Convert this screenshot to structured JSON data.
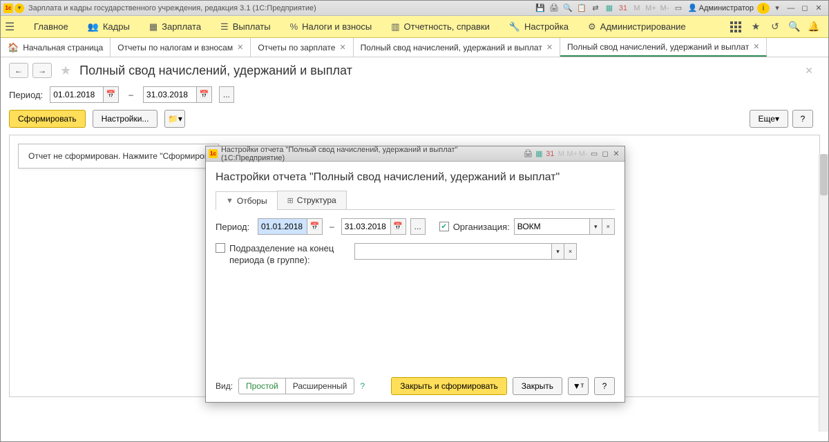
{
  "titlebar": {
    "app_title": "Зарплата и кадры государственного учреждения, редакция 3.1  (1С:Предприятие)",
    "admin_label": "Администратор",
    "m_labels": [
      "M",
      "M+",
      "M-"
    ]
  },
  "menu": {
    "items": [
      {
        "icon": "≡",
        "label": "Главное"
      },
      {
        "icon": "👥",
        "label": "Кадры"
      },
      {
        "icon": "▦",
        "label": "Зарплата"
      },
      {
        "icon": "☰",
        "label": "Выплаты"
      },
      {
        "icon": "%",
        "label": "Налоги и взносы"
      },
      {
        "icon": "▥",
        "label": "Отчетность, справки"
      },
      {
        "icon": "🔧",
        "label": "Настройка"
      },
      {
        "icon": "⚙",
        "label": "Администрирование"
      }
    ]
  },
  "tabs": [
    {
      "label": "Начальная страница",
      "closable": false,
      "home": true
    },
    {
      "label": "Отчеты по налогам и взносам",
      "closable": true
    },
    {
      "label": "Отчеты по зарплате",
      "closable": true
    },
    {
      "label": "Полный свод начислений, удержаний и выплат",
      "closable": true
    },
    {
      "label": "Полный свод начислений, удержаний и выплат",
      "closable": true,
      "active": true
    }
  ],
  "page": {
    "title": "Полный свод начислений, удержаний и выплат",
    "period_label": "Период:",
    "date_from": "01.01.2018",
    "date_to": "31.03.2018",
    "dash": "–",
    "btn_form": "Сформировать",
    "btn_settings": "Настройки...",
    "btn_more": "Еще",
    "btn_help": "?",
    "report_msg": "Отчет не сформирован. Нажмите \"Сформиров"
  },
  "dialog": {
    "title": "Настройки отчета \"Полный свод начислений, удержаний и выплат\"  (1С:Предприятие)",
    "heading": "Настройки отчета \"Полный свод начислений, удержаний и выплат\"",
    "tab_filters": "Отборы",
    "tab_structure": "Структура",
    "period_label": "Период:",
    "date_from": "01.01.2018",
    "date_to": "31.03.2018",
    "dash": "–",
    "org_label": "Организация:",
    "org_value": "ВОКМ",
    "dept_label": "Подразделение на конец периода (в группе):",
    "view_label": "Вид:",
    "view_simple": "Простой",
    "view_ext": "Расширенный",
    "help": "?",
    "btn_apply": "Закрыть и сформировать",
    "btn_close": "Закрыть",
    "m_labels": [
      "M",
      "M+",
      "M-"
    ]
  }
}
